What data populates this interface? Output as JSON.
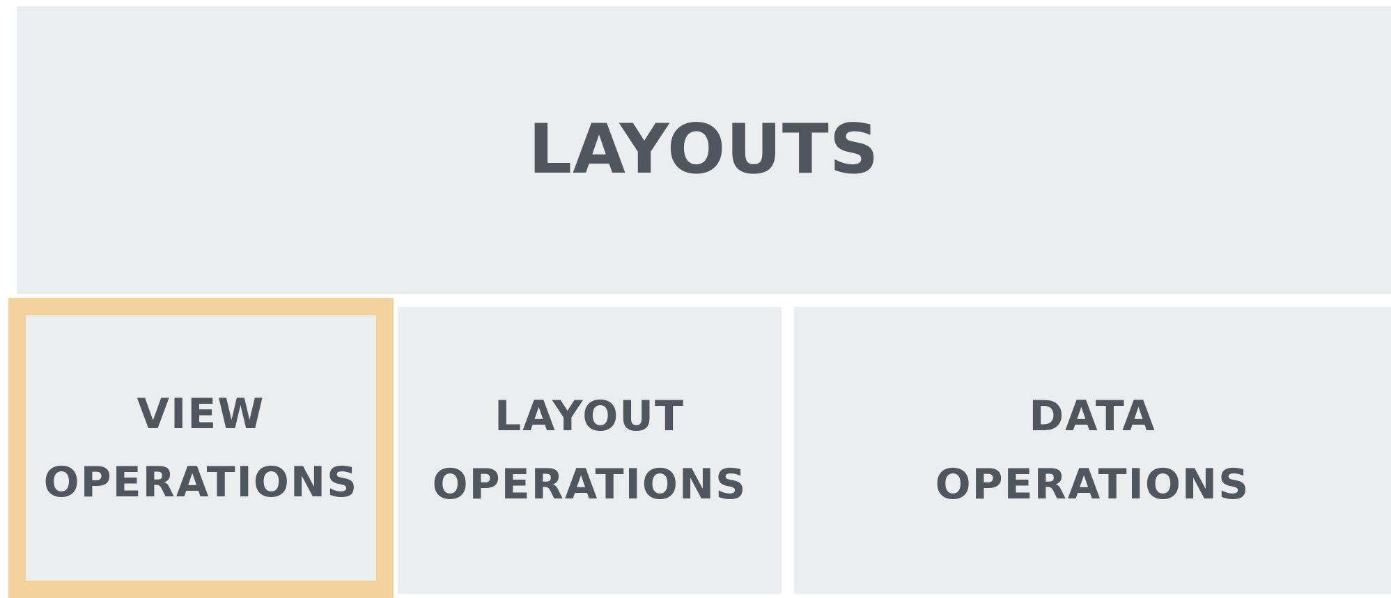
{
  "diagram": {
    "top": {
      "label": "LAYOUTS"
    },
    "children": [
      {
        "line1": "VIEW",
        "line2": "OPERATIONS",
        "highlighted": true
      },
      {
        "line1": "LAYOUT",
        "line2": "OPERATIONS",
        "highlighted": false
      },
      {
        "line1": "DATA",
        "line2": "OPERATIONS",
        "highlighted": false
      }
    ]
  },
  "colors": {
    "box_fill": "#ecedef",
    "text": "#50565d",
    "highlight_border": "#f4d29b",
    "background": "#ffffff"
  }
}
